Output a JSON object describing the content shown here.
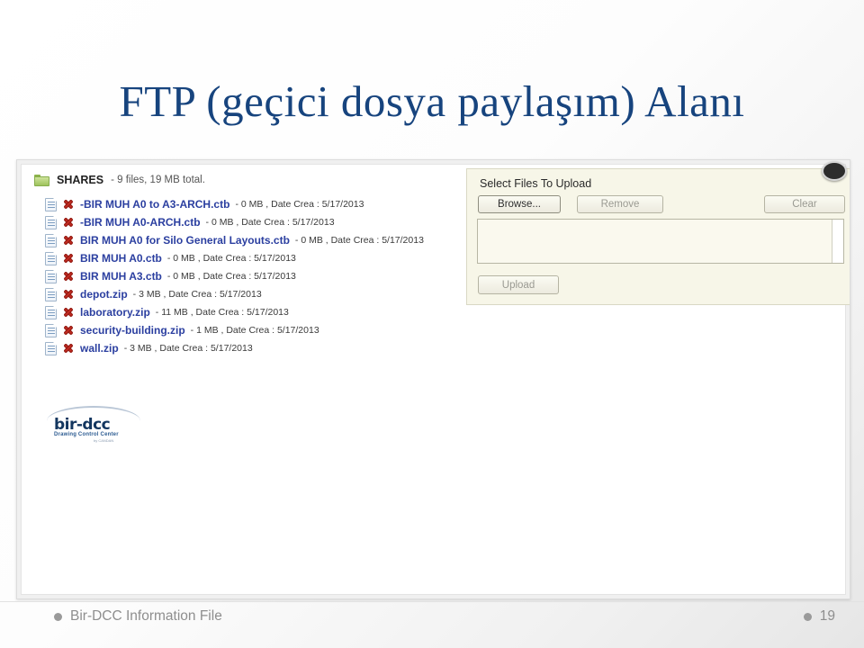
{
  "slide": {
    "title": "FTP (geçici dosya paylaşım) Alanı",
    "title_color": "#17447e"
  },
  "screenshot": {
    "shares": {
      "folder_icon": "folder-icon",
      "title": "SHARES",
      "meta": " - 9 files, 19 MB total.",
      "files": [
        {
          "name": "-BIR MUH A0 to A3-ARCH.ctb",
          "meta": " - 0 MB , Date Crea : 5/17/2013"
        },
        {
          "name": "-BIR MUH A0-ARCH.ctb",
          "meta": " - 0 MB , Date Crea : 5/17/2013"
        },
        {
          "name": "BIR MUH A0 for Silo General Layouts.ctb",
          "meta": " - 0 MB , Date Crea : 5/17/2013"
        },
        {
          "name": "BIR MUH A0.ctb",
          "meta": " - 0 MB , Date Crea : 5/17/2013"
        },
        {
          "name": "BIR MUH A3.ctb",
          "meta": " - 0 MB , Date Crea : 5/17/2013"
        },
        {
          "name": "depot.zip",
          "meta": " - 3 MB , Date Crea : 5/17/2013"
        },
        {
          "name": "laboratory.zip",
          "meta": " - 11 MB , Date Crea : 5/17/2013"
        },
        {
          "name": "security-building.zip",
          "meta": " - 1 MB , Date Crea : 5/17/2013"
        },
        {
          "name": "wall.zip",
          "meta": " - 3 MB , Date Crea : 5/17/2013"
        }
      ],
      "file_name_color": "#2b3fa0",
      "delete_icon_color": "#c22a20"
    },
    "logo": {
      "name": "bir-dcc",
      "tagline": "Drawing Control Center",
      "subtagline": "by CANDAN"
    },
    "uploader": {
      "label": "Select Files To Upload",
      "browse_button": "Browse...",
      "remove_button": "Remove",
      "clear_button": "Clear",
      "upload_button": "Upload",
      "filelist_value": "",
      "panel_color": "#f7f6e8"
    }
  },
  "footer": {
    "left_text": "Bir-DCC Information File",
    "page_number": "19"
  }
}
